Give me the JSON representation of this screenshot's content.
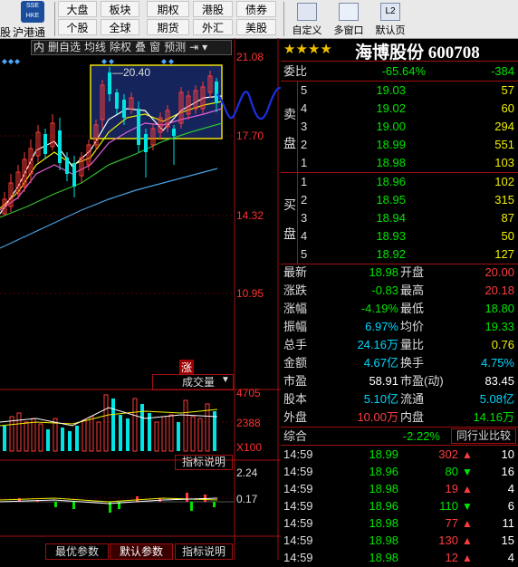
{
  "toolbar": {
    "left_cut": [
      "股",
      "沪港通"
    ],
    "row1": [
      "大盘",
      "板块",
      "期权",
      "港股",
      "债券"
    ],
    "row2": [
      "个股",
      "全球",
      "期货",
      "外汇",
      "美股"
    ],
    "tools": [
      "自定义",
      "多窗口",
      "默认页"
    ],
    "logo": "SSE HKE"
  },
  "chart_menu": [
    "内",
    "删自选",
    "均线",
    "除权",
    "叠",
    "窗",
    "预测"
  ],
  "price_axis": [
    "21.08",
    "17.70",
    "14.32",
    "10.95"
  ],
  "zoom_label": "20.40",
  "volume": {
    "tab_label": "成交量",
    "axis": [
      "4705",
      "2388",
      "X100"
    ],
    "marker": "涨",
    "indicator_button": "指标说明"
  },
  "macd": {
    "axis": [
      "2.24",
      "0.17"
    ],
    "indicator_button": "指标说明"
  },
  "bottom_tabs": [
    "最优参数",
    "默认参数",
    "指标说明"
  ],
  "stock": {
    "stars": "★★★★",
    "name": "海博股份",
    "code": "600708"
  },
  "weibi": {
    "label": "委比",
    "pct": "-65.64%",
    "diff": "-384"
  },
  "sell_label": [
    "卖",
    "盘"
  ],
  "buy_label": [
    "买",
    "盘"
  ],
  "sell_orders": [
    {
      "level": "5",
      "price": "19.03",
      "volume": "57"
    },
    {
      "level": "4",
      "price": "19.02",
      "volume": "60"
    },
    {
      "level": "3",
      "price": "19.00",
      "volume": "294"
    },
    {
      "level": "2",
      "price": "18.99",
      "volume": "551"
    },
    {
      "level": "1",
      "price": "18.98",
      "volume": "103"
    }
  ],
  "buy_orders": [
    {
      "level": "1",
      "price": "18.96",
      "volume": "102"
    },
    {
      "level": "2",
      "price": "18.95",
      "volume": "315"
    },
    {
      "level": "3",
      "price": "18.94",
      "volume": "87"
    },
    {
      "level": "4",
      "price": "18.93",
      "volume": "50"
    },
    {
      "level": "5",
      "price": "18.92",
      "volume": "127"
    }
  ],
  "quote": [
    {
      "l1": "最新",
      "v1": "18.98",
      "l2": "开盘",
      "v2": "20.00",
      "c1": "green",
      "c2": "red"
    },
    {
      "l1": "涨跌",
      "v1": "-0.83",
      "l2": "最高",
      "v2": "20.18",
      "c1": "green",
      "c2": "red"
    },
    {
      "l1": "涨幅",
      "v1": "-4.19%",
      "l2": "最低",
      "v2": "18.80",
      "c1": "green",
      "c2": "green"
    },
    {
      "l1": "振幅",
      "v1": "6.97%",
      "l2": "均价",
      "v2": "19.33",
      "c1": "cyan",
      "c2": "green"
    },
    {
      "l1": "总手",
      "v1": "24.16万",
      "l2": "量比",
      "v2": "0.76",
      "c1": "cyan",
      "c2": "yellow"
    },
    {
      "l1": "金额",
      "v1": "4.67亿",
      "l2": "换手",
      "v2": "4.75%",
      "c1": "cyan",
      "c2": "cyan"
    },
    {
      "l1": "市盈",
      "v1": "58.91",
      "l2": "市盈(动)",
      "v2": "83.45",
      "c1": "white",
      "c2": "white"
    },
    {
      "l1": "股本",
      "v1": "5.10亿",
      "l2": "流通",
      "v2": "5.08亿",
      "c1": "cyan",
      "c2": "cyan"
    },
    {
      "l1": "外盘",
      "v1": "10.00万",
      "l2": "内盘",
      "v2": "14.16万",
      "c1": "red",
      "c2": "green"
    }
  ],
  "comprehensive": {
    "label": "综合",
    "value": "-2.22%",
    "button": "同行业比较"
  },
  "ticks": [
    {
      "time": "14:59",
      "price": "18.99",
      "vol": "302",
      "dir": "up",
      "n": "10"
    },
    {
      "time": "14:59",
      "price": "18.96",
      "vol": "80",
      "dir": "down",
      "n": "16"
    },
    {
      "time": "14:59",
      "price": "18.98",
      "vol": "19",
      "dir": "up",
      "n": "4"
    },
    {
      "time": "14:59",
      "price": "18.96",
      "vol": "110",
      "dir": "down",
      "n": "6"
    },
    {
      "time": "14:59",
      "price": "18.98",
      "vol": "77",
      "dir": "up",
      "n": "11"
    },
    {
      "time": "14:59",
      "price": "18.98",
      "vol": "130",
      "dir": "up",
      "n": "15"
    },
    {
      "time": "14:59",
      "price": "18.98",
      "vol": "12",
      "dir": "up",
      "n": "4"
    }
  ],
  "colors": {
    "up": "#ff3c3c",
    "down": "#00e400",
    "accent": "#00d8ff",
    "price_axis": "#ff3030"
  }
}
